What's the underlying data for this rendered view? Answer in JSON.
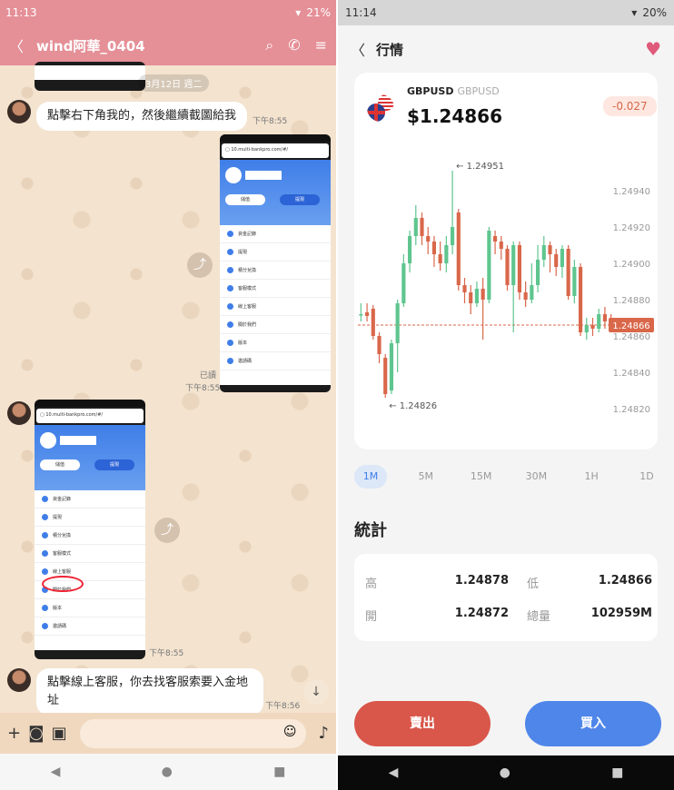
{
  "left": {
    "status": {
      "time": "11:13",
      "battery": "21%"
    },
    "header": {
      "title": "wind阿華_0404"
    },
    "date_pill": "3月12日 週二",
    "messages": [
      {
        "text": "點擊右下角我的，然後繼續截圖給我",
        "time": "下午8:55"
      },
      {
        "text": "點擊線上客服，你去找客服索要入金地址",
        "time": "下午8:56"
      }
    ],
    "image_times": {
      "sent_read": "已讀",
      "sent_time": "下午8:55",
      "recv_time": "下午8:55"
    },
    "shot_menu": [
      "資金記錄",
      "提現",
      "積分兌換",
      "客服模式",
      "線上客服",
      "關於我們",
      "版本",
      "邀請碼"
    ],
    "shot_buttons": [
      "儲值",
      "提現"
    ]
  },
  "right": {
    "status": {
      "time": "11:14",
      "battery": "20%"
    },
    "header": {
      "title": "行情"
    },
    "pair": "GBPUSD",
    "pair_sub": "GBPUSD",
    "price": "$1.24866",
    "change": "-0.027",
    "chart_data": {
      "type": "candlestick",
      "y_ticks": [
        "1.24940",
        "1.24920",
        "1.24900",
        "1.24880",
        "1.24860",
        "1.24840",
        "1.24820"
      ],
      "ylim": [
        1.24815,
        1.24955
      ],
      "high_label": "1.24951",
      "low_label": "1.24826",
      "current_label": "1.24866",
      "current": 1.24866,
      "candles": [
        [
          1.24872,
          1.24872,
          1.24878,
          1.24868
        ],
        [
          1.24873,
          1.24871,
          1.24878,
          1.24868
        ],
        [
          1.24875,
          1.2486,
          1.24877,
          1.24858
        ],
        [
          1.2486,
          1.2485,
          1.24862,
          1.24845
        ],
        [
          1.24848,
          1.24828,
          1.2485,
          1.24826
        ],
        [
          1.2483,
          1.24856,
          1.24858,
          1.24828
        ],
        [
          1.24856,
          1.24878,
          1.2488,
          1.2484
        ],
        [
          1.24878,
          1.249,
          1.24905,
          1.24876
        ],
        [
          1.249,
          1.24915,
          1.24918,
          1.24895
        ],
        [
          1.24915,
          1.24925,
          1.24932,
          1.2491
        ],
        [
          1.24925,
          1.24915,
          1.24928,
          1.2491
        ],
        [
          1.24915,
          1.24912,
          1.2492,
          1.24905
        ],
        [
          1.24912,
          1.24905,
          1.24915,
          1.24898
        ],
        [
          1.24905,
          1.249,
          1.24912,
          1.24896
        ],
        [
          1.249,
          1.2491,
          1.24915,
          1.24895
        ],
        [
          1.2491,
          1.2492,
          1.24951,
          1.24905
        ],
        [
          1.24928,
          1.24888,
          1.2493,
          1.24885
        ],
        [
          1.24888,
          1.24884,
          1.24892,
          1.24878
        ],
        [
          1.24884,
          1.24878,
          1.24888,
          1.24872
        ],
        [
          1.24878,
          1.24886,
          1.2489,
          1.24876
        ],
        [
          1.24886,
          1.2488,
          1.24892,
          1.24858
        ],
        [
          1.2488,
          1.24918,
          1.2492,
          1.24878
        ],
        [
          1.24915,
          1.24912,
          1.24918,
          1.24905
        ],
        [
          1.24912,
          1.24908,
          1.24915,
          1.24902
        ],
        [
          1.24908,
          1.24888,
          1.2491,
          1.24885
        ],
        [
          1.24888,
          1.2491,
          1.24912,
          1.24862
        ],
        [
          1.2491,
          1.24884,
          1.24912,
          1.2488
        ],
        [
          1.24884,
          1.2488,
          1.2489,
          1.24876
        ],
        [
          1.2488,
          1.24888,
          1.249,
          1.24878
        ],
        [
          1.24888,
          1.24902,
          1.2491,
          1.24884
        ],
        [
          1.24902,
          1.2491,
          1.24915,
          1.24898
        ],
        [
          1.2491,
          1.24905,
          1.24912,
          1.24895
        ],
        [
          1.24905,
          1.24898,
          1.24908,
          1.24893
        ],
        [
          1.24898,
          1.24908,
          1.2491,
          1.24892
        ],
        [
          1.24908,
          1.24882,
          1.2491,
          1.2488
        ],
        [
          1.24882,
          1.24898,
          1.24902,
          1.24878
        ],
        [
          1.24898,
          1.24862,
          1.249,
          1.2486
        ],
        [
          1.24862,
          1.24866,
          1.2487,
          1.24858
        ],
        [
          1.24866,
          1.24864,
          1.2487,
          1.2486
        ],
        [
          1.24864,
          1.24872,
          1.24875,
          1.24862
        ],
        [
          1.24872,
          1.24868,
          1.24876,
          1.24864
        ],
        [
          1.24868,
          1.24866,
          1.24872,
          1.24864
        ]
      ]
    },
    "timeframes": [
      "1M",
      "5M",
      "15M",
      "30M",
      "1H",
      "1D"
    ],
    "active_timeframe": "1M",
    "stats_title": "統計",
    "stats": [
      {
        "label": "高",
        "value": "1.24878"
      },
      {
        "label": "低",
        "value": "1.24866"
      },
      {
        "label": "開",
        "value": "1.24872"
      },
      {
        "label": "總量",
        "value": "102959M"
      }
    ],
    "sell_label": "賣出",
    "buy_label": "買入",
    "colors": {
      "up": "#5fc58f",
      "down": "#d9674a",
      "buy": "#4f86ea",
      "sell": "#d9574a"
    }
  }
}
